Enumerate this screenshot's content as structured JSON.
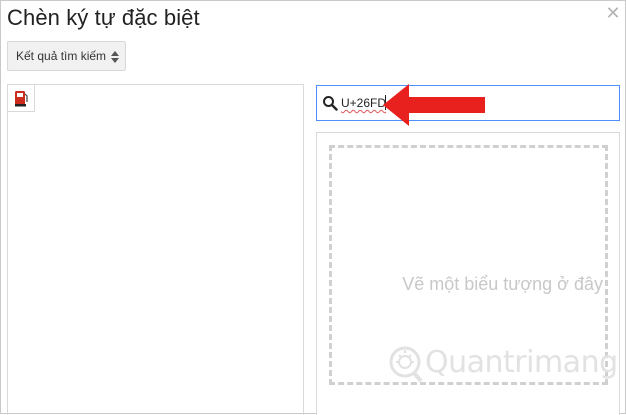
{
  "dialog": {
    "title": "Chèn ký tự đặc biệt",
    "close_icon": "close-icon"
  },
  "filter": {
    "selected": "Kết quả tìm kiếm",
    "icon": "updown-caret-icon"
  },
  "results": {
    "items": [
      {
        "icon": "fuel-pump-icon",
        "color": "#cc2b1d"
      }
    ]
  },
  "search": {
    "icon": "search-icon",
    "value": "U+26FD"
  },
  "annotation": {
    "arrow_color": "#e8211e"
  },
  "draw": {
    "hint": "Vẽ một biểu tượng ở đây"
  },
  "watermark": {
    "text": "Quantrimang"
  },
  "colors": {
    "focus_border": "#4d90fe",
    "panel_border": "#d9d9d9"
  }
}
